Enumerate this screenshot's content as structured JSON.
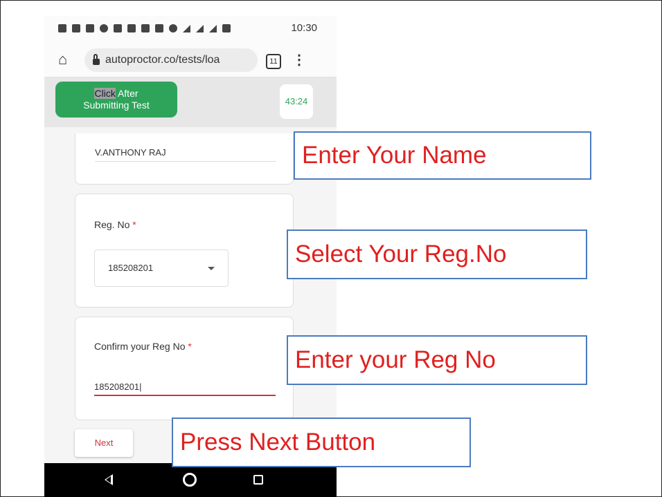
{
  "status_bar": {
    "time": "10:30"
  },
  "browser": {
    "url": "autoproctor.co/tests/loa",
    "tab_count": "11"
  },
  "header": {
    "submit_line1_highlight": "Click",
    "submit_line1_rest": " After",
    "submit_line2": "Submitting Test",
    "timer": "43:24",
    "submit_color": "#2ea35a"
  },
  "form": {
    "name_value": "V.ANTHONY RAJ",
    "reg_label": "Reg. No",
    "reg_selected": "185208201",
    "confirm_label": "Confirm your Reg No",
    "required_mark": "*",
    "confirm_value": "185208201|",
    "next_label": "Next"
  },
  "callouts": {
    "name": "Enter Your Name",
    "reg": "Select Your Reg.No",
    "confirm": "Enter your Reg No",
    "next": "Press Next Button"
  },
  "icons": [
    "home-icon",
    "lock-icon",
    "tabs-icon",
    "menu-icon",
    "caret-down-icon",
    "back-icon",
    "home-circle-icon",
    "recents-icon"
  ]
}
